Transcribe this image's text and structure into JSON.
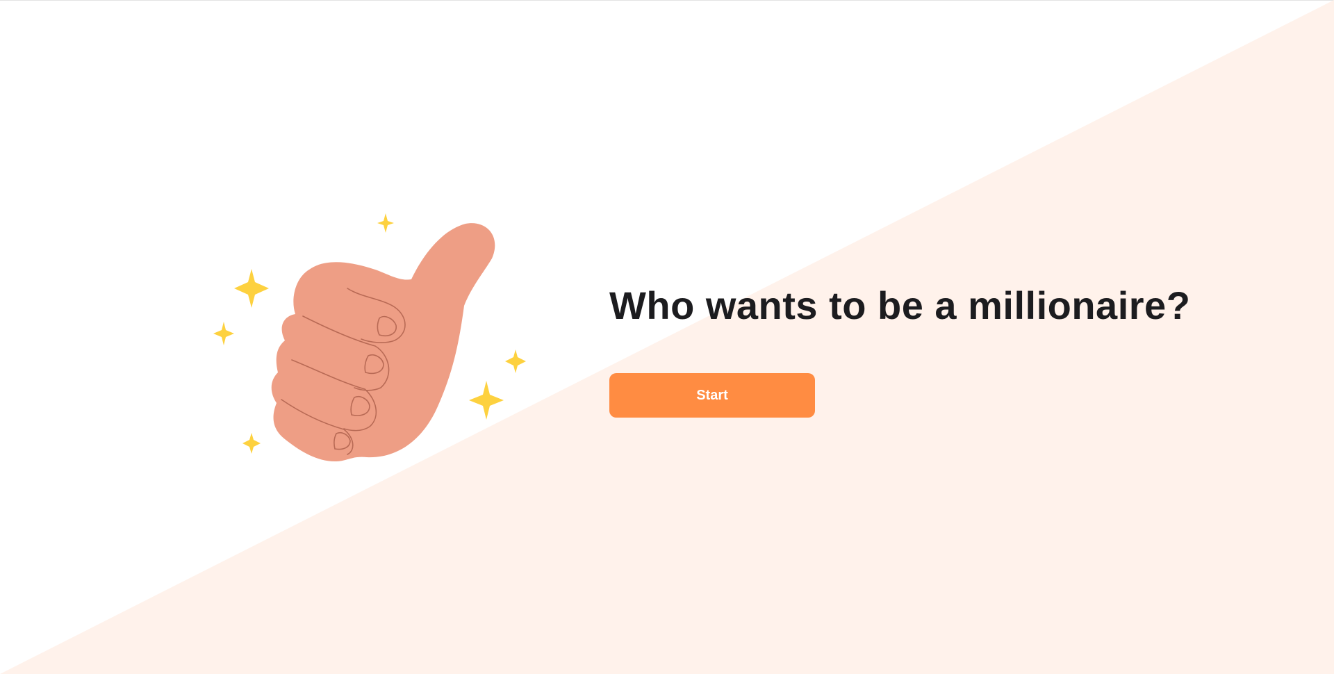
{
  "hero": {
    "title": "Who wants to be a millionaire?",
    "start_label": "Start"
  },
  "illustration": {
    "icon": "thumbs-up-hand-icon",
    "sparkle_icon": "sparkle-icon"
  },
  "colors": {
    "background": "#ffffff",
    "accent_triangle": "#fff2eb",
    "button": "#ff8c42",
    "button_text": "#ffffff",
    "title": "#1c1c1f",
    "skin": "#ee9e85",
    "skin_line": "#b86a55",
    "sparkle": "#fdd13f"
  }
}
